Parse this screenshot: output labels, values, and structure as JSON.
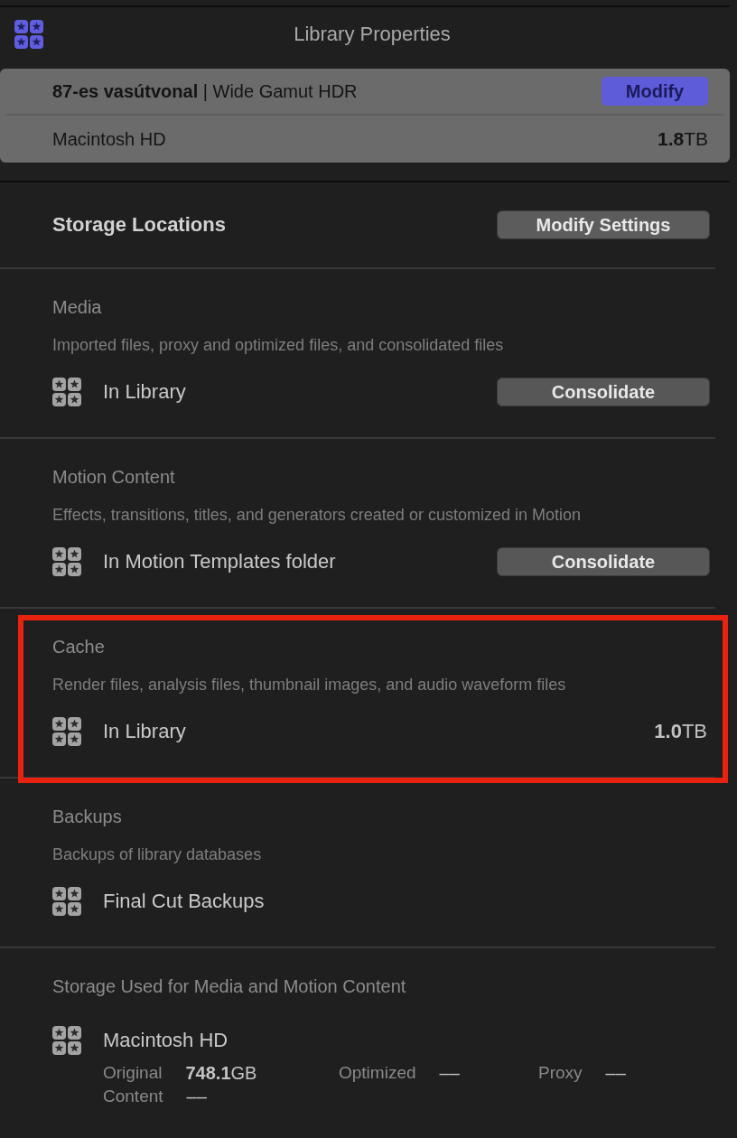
{
  "header": {
    "title": "Library Properties"
  },
  "library": {
    "name_line": "**87-es vasútvonal** | Wide Gamut HDR",
    "action": "Modify",
    "disk": "Macintosh HD",
    "size": "**1.8**TB"
  },
  "storage_locations": {
    "title": "Storage Locations",
    "action": "Modify Settings"
  },
  "sections": [
    {
      "title": "Media",
      "description": "Imported files, proxy and optimized files, and consolidated files",
      "location": "In Library",
      "action": "Consolidate",
      "highlighted": false
    },
    {
      "title": "Motion Content",
      "description": "Effects, transitions, titles, and generators created or customized in Motion",
      "location": "In Motion Templates folder",
      "action": "Consolidate",
      "highlighted": false
    },
    {
      "title": "Cache",
      "description": "Render files, analysis files, thumbnail images, and audio waveform files",
      "location": "In Library",
      "size": "**1.0**TB",
      "highlighted": true
    },
    {
      "title": "Backups",
      "description": "Backups of library databases",
      "location": "Final Cut Backups",
      "highlighted": false
    }
  ],
  "storage_used": {
    "title": "Storage Used for Media and Motion Content",
    "disk": "Macintosh HD",
    "stats": [
      {
        "label": "Original",
        "value": "**748.1**GB"
      },
      {
        "label": "Optimized",
        "value": "––"
      },
      {
        "label": "Proxy",
        "value": "––"
      },
      {
        "label": "Content",
        "value": "––"
      }
    ]
  }
}
